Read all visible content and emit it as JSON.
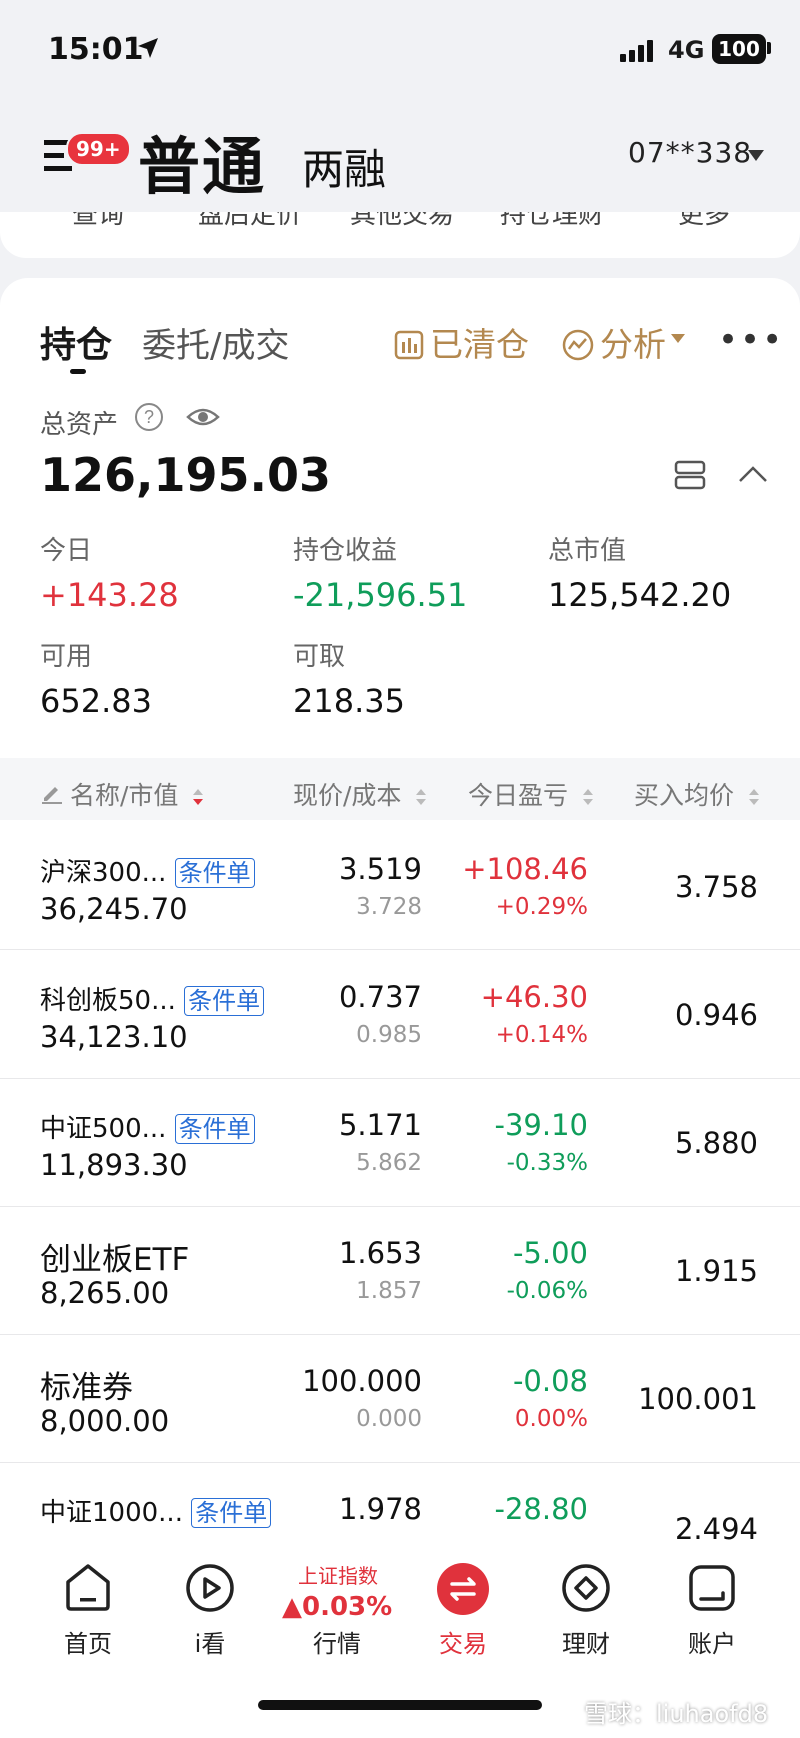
{
  "status_bar": {
    "time": "15:01",
    "network": "4G",
    "battery": "100"
  },
  "header": {
    "menu_badge": "99+",
    "tab_active": "普通",
    "tab_other": "两融",
    "account": "07**338"
  },
  "quick_menu": [
    "查询",
    "盘后定价",
    "其他交易",
    "持仓理财",
    "更多"
  ],
  "tabs": {
    "holdings": "持仓",
    "orders": "委托/成交"
  },
  "actions": {
    "cleared": "已清仓",
    "analysis": "分析",
    "more": "•••"
  },
  "assets": {
    "total_label": "总资产",
    "total_value": "126,195.03",
    "today_label": "今日",
    "today_value": "+143.28",
    "pl_label": "持仓收益",
    "pl_value": "-21,596.51",
    "mv_label": "总市值",
    "mv_value": "125,542.20",
    "avail_label": "可用",
    "avail_value": "652.83",
    "withdraw_label": "可取",
    "withdraw_value": "218.35"
  },
  "table_header": {
    "name": "名称/市值",
    "price": "现价/成本",
    "today": "今日盈亏",
    "avg": "买入均价"
  },
  "rows": [
    {
      "name": "沪深300...",
      "tag": "条件单",
      "mv": "36,245.70",
      "price": "3.519",
      "cost": "3.728",
      "pl": "+108.46",
      "pct": "+0.29%",
      "avg": "3.758"
    },
    {
      "name": "科创板50...",
      "tag": "条件单",
      "mv": "34,123.10",
      "price": "0.737",
      "cost": "0.985",
      "pl": "+46.30",
      "pct": "+0.14%",
      "avg": "0.946"
    },
    {
      "name": "中证500...",
      "tag": "条件单",
      "mv": "11,893.30",
      "price": "5.171",
      "cost": "5.862",
      "pl": "-39.10",
      "pct": "-0.33%",
      "avg": "5.880"
    },
    {
      "name": "创业板ETF",
      "tag": "",
      "mv": "8,265.00",
      "price": "1.653",
      "cost": "1.857",
      "pl": "-5.00",
      "pct": "-0.06%",
      "avg": "1.915"
    },
    {
      "name": "标准券",
      "tag": "",
      "mv": "8,000.00",
      "price": "100.000",
      "cost": "0.000",
      "pl": "-0.08",
      "pct": "0.00%",
      "avg": "100.001"
    },
    {
      "name": "中证1000...",
      "tag": "条件单",
      "mv": "",
      "price": "1.978",
      "cost": "",
      "pl": "-28.80",
      "pct": "",
      "avg": "2.494"
    }
  ],
  "index": {
    "name": "上证指数",
    "value": "▲0.03%"
  },
  "nav": [
    "首页",
    "i看",
    "行情",
    "交易",
    "理财",
    "账户"
  ],
  "watermark": "雪球：liuhaofd8",
  "colors": {
    "up": "#e0323c",
    "down": "#0f9d5a",
    "accent": "#b3884f",
    "link": "#2a6fd6"
  }
}
